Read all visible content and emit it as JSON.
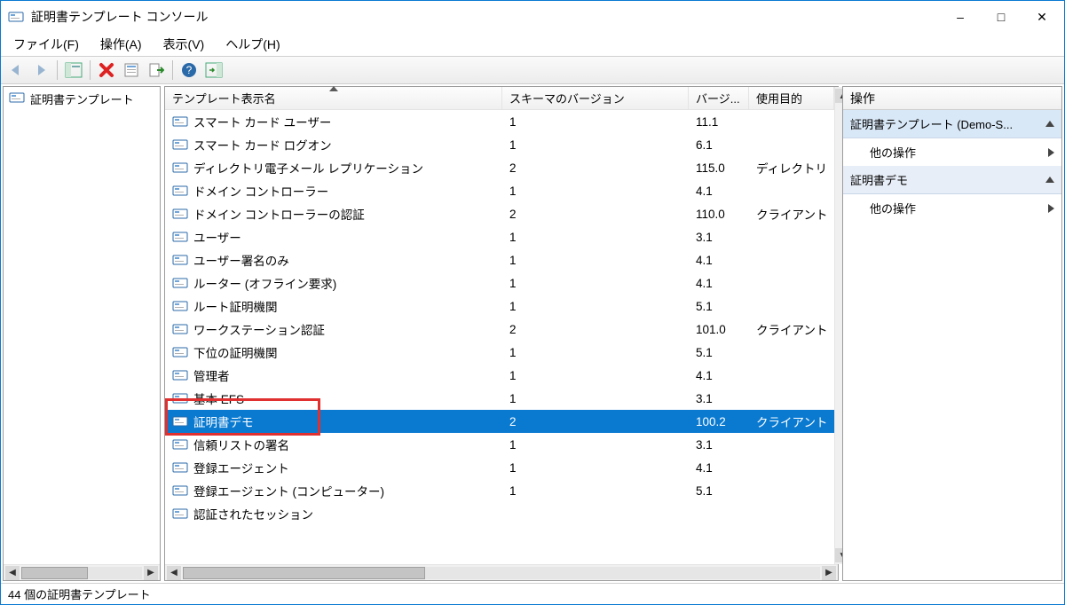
{
  "window": {
    "title": "証明書テンプレート コンソール"
  },
  "menu": {
    "file": "ファイル(F)",
    "action": "操作(A)",
    "view": "表示(V)",
    "help": "ヘルプ(H)"
  },
  "tree": {
    "root": "証明書テンプレート"
  },
  "columns": {
    "name": "テンプレート表示名",
    "schema": "スキーマのバージョン",
    "version": "バージ...",
    "usage": "使用目的"
  },
  "rows": [
    {
      "name": "スマート カード ユーザー",
      "schema": "1",
      "version": "11.1",
      "usage": ""
    },
    {
      "name": "スマート カード ログオン",
      "schema": "1",
      "version": "6.1",
      "usage": ""
    },
    {
      "name": "ディレクトリ電子メール レプリケーション",
      "schema": "2",
      "version": "115.0",
      "usage": "ディレクトリ"
    },
    {
      "name": "ドメイン コントローラー",
      "schema": "1",
      "version": "4.1",
      "usage": ""
    },
    {
      "name": "ドメイン コントローラーの認証",
      "schema": "2",
      "version": "110.0",
      "usage": "クライアント"
    },
    {
      "name": "ユーザー",
      "schema": "1",
      "version": "3.1",
      "usage": ""
    },
    {
      "name": "ユーザー署名のみ",
      "schema": "1",
      "version": "4.1",
      "usage": ""
    },
    {
      "name": "ルーター (オフライン要求)",
      "schema": "1",
      "version": "4.1",
      "usage": ""
    },
    {
      "name": "ルート証明機関",
      "schema": "1",
      "version": "5.1",
      "usage": ""
    },
    {
      "name": "ワークステーション認証",
      "schema": "2",
      "version": "101.0",
      "usage": "クライアント"
    },
    {
      "name": "下位の証明機関",
      "schema": "1",
      "version": "5.1",
      "usage": ""
    },
    {
      "name": "管理者",
      "schema": "1",
      "version": "4.1",
      "usage": ""
    },
    {
      "name": "基本 EFS",
      "schema": "1",
      "version": "3.1",
      "usage": ""
    },
    {
      "name": "証明書デモ",
      "schema": "2",
      "version": "100.2",
      "usage": "クライアント",
      "selected": true
    },
    {
      "name": "信頼リストの署名",
      "schema": "1",
      "version": "3.1",
      "usage": ""
    },
    {
      "name": "登録エージェント",
      "schema": "1",
      "version": "4.1",
      "usage": ""
    },
    {
      "name": "登録エージェント (コンピューター)",
      "schema": "1",
      "version": "5.1",
      "usage": ""
    },
    {
      "name": "認証されたセッション",
      "schema": "",
      "version": "",
      "usage": ""
    }
  ],
  "actions": {
    "header": "操作",
    "section1": "証明書テンプレート (Demo-S...",
    "link1": "他の操作",
    "section2": "証明書デモ",
    "link2": "他の操作"
  },
  "status": "44 個の証明書テンプレート"
}
